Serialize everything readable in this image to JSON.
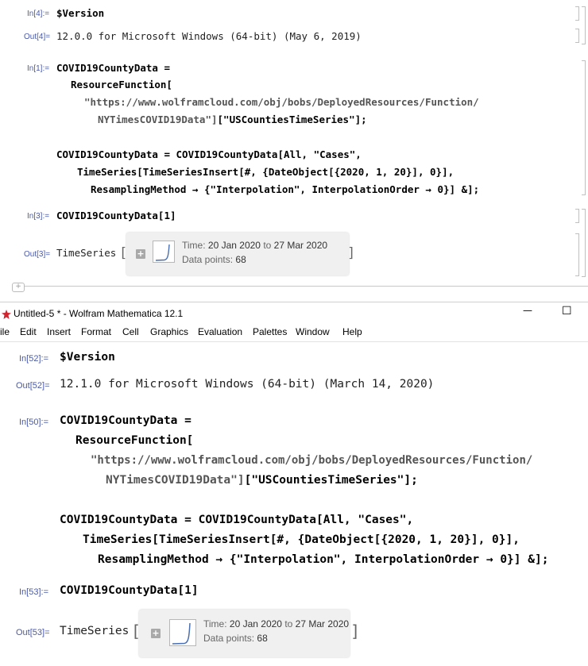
{
  "top": {
    "cells": {
      "in4_label": "In[4]:=",
      "in4_code": "$Version",
      "out4_label": "Out[4]=",
      "out4_value": "12.0.0 for Microsoft Windows (64-bit) (May 6, 2019)",
      "in1_label": "In[1]:=",
      "in1_line1": "COVID19CountyData =",
      "in1_line2": "ResourceFunction[",
      "in1_line3": "\"https://www.wolframcloud.com/obj/bobs/DeployedResources/Function/",
      "in1_line4a": "NYTimesCOVID19Data\"]",
      "in1_line4b": "[\"USCountiesTimeSeries\"];",
      "in1_line5": "COVID19CountyData = COVID19CountyData[All, \"Cases\",",
      "in1_line6": "TimeSeries[TimeSeriesInsert[#, {DateObject[{2020, 1, 20}], 0}],",
      "in1_line7": "ResamplingMethod → {\"Interpolation\", InterpolationOrder → 0}] &];",
      "in3_label": "In[3]:=",
      "in3_code": "COVID19CountyData[1]",
      "out3_label": "Out[3]=",
      "out3_head": "TimeSeries"
    },
    "timeseries": {
      "time_label": "Time:",
      "time_from": "20 Jan 2020",
      "time_to_word": "to",
      "time_to": "27 Mar 2020",
      "points_label": "Data points:",
      "points_value": "68",
      "plus": "+"
    }
  },
  "window": {
    "title": "Untitled-5 * - Wolfram Mathematica 12.1",
    "minimize": "—",
    "maximize": "☐",
    "app_icon": "mathematica-spikey-icon"
  },
  "menu": [
    "ile",
    "Edit",
    "Insert",
    "Format",
    "Cell",
    "Graphics",
    "Evaluation",
    "Palettes",
    "Window",
    "Help"
  ],
  "bottom": {
    "cells": {
      "in52_label": "In[52]:=",
      "in52_code": "$Version",
      "out52_label": "Out[52]=",
      "out52_value": "12.1.0 for Microsoft Windows (64-bit) (March 14, 2020)",
      "in50_label": "In[50]:=",
      "in50_line1": "COVID19CountyData =",
      "in50_line2": "ResourceFunction[",
      "in50_line3": "\"https://www.wolframcloud.com/obj/bobs/DeployedResources/Function/",
      "in50_line4a": "NYTimesCOVID19Data\"]",
      "in50_line4b": "[\"USCountiesTimeSeries\"];",
      "in50_line5": "COVID19CountyData = COVID19CountyData[All, \"Cases\",",
      "in50_line6": "TimeSeries[TimeSeriesInsert[#, {DateObject[{2020, 1, 20}], 0}],",
      "in50_line7": "ResamplingMethod → {\"Interpolation\", InterpolationOrder → 0}] &];",
      "in53_label": "In[53]:=",
      "in53_code": "COVID19CountyData[1]",
      "out53_label": "Out[53]=",
      "out53_head": "TimeSeries"
    },
    "timeseries": {
      "time_label": "Time:",
      "time_from": "20 Jan 2020",
      "time_to_word": "to",
      "time_to": "27 Mar 2020",
      "points_label": "Data points:",
      "points_value": "68",
      "plus": "+"
    }
  },
  "colors": {
    "label_blue": "#4a5aa8",
    "string_gray": "#555555",
    "slot_teal": "#3a8a8a"
  }
}
